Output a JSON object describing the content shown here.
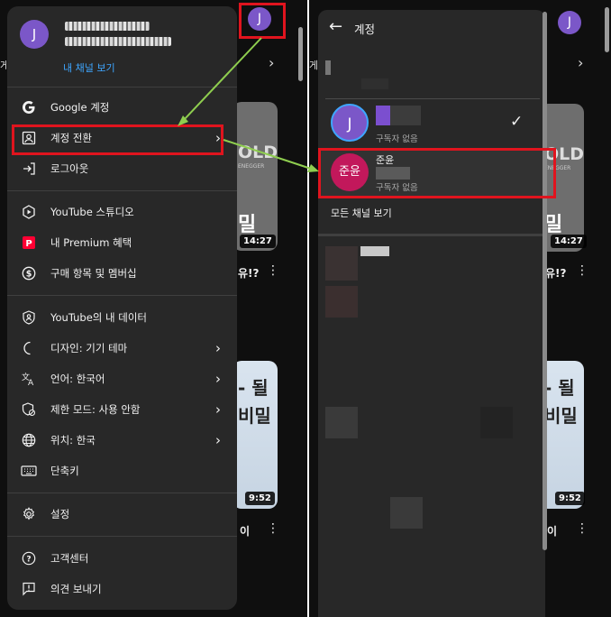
{
  "left": {
    "background": {
      "avatar_letter": "J",
      "edge_text": "게잍",
      "video1": {
        "thumb_text": "OLD",
        "thumb_subtext": "ENEGGER",
        "bottom_text": "밀",
        "duration": "14:27",
        "title": "유!?"
      },
      "video2": {
        "thumb_text": "- 될",
        "thumb_text2": "비밀",
        "duration": "9:52",
        "title": "이"
      }
    },
    "menu": {
      "avatar_letter": "J",
      "view_channel": "내 채널 보기",
      "items": [
        {
          "label": "Google 계정",
          "icon": "google-icon"
        },
        {
          "label": "계정 전환",
          "icon": "switch-account-icon",
          "chevron": true
        },
        {
          "label": "로그아웃",
          "icon": "logout-icon"
        },
        {
          "label": "YouTube 스튜디오",
          "icon": "studio-icon"
        },
        {
          "label": "내 Premium 혜택",
          "icon": "premium-icon"
        },
        {
          "label": "구매 항목 및 멤버십",
          "icon": "dollar-icon"
        },
        {
          "label": "YouTube의 내 데이터",
          "icon": "shield-user-icon"
        },
        {
          "label": "디자인: 기기 테마",
          "icon": "moon-icon",
          "chevron": true
        },
        {
          "label": "언어: 한국어",
          "icon": "translate-icon",
          "chevron": true
        },
        {
          "label": "제한 모드: 사용 안함",
          "icon": "restricted-icon",
          "chevron": true
        },
        {
          "label": "위치: 한국",
          "icon": "globe-icon",
          "chevron": true
        },
        {
          "label": "단축키",
          "icon": "keyboard-icon"
        },
        {
          "label": "설정",
          "icon": "gear-icon"
        },
        {
          "label": "고객센터",
          "icon": "help-icon"
        },
        {
          "label": "의견 보내기",
          "icon": "feedback-icon"
        }
      ]
    }
  },
  "right": {
    "background": {
      "avatar_letter": "J",
      "edge_text": "게잍",
      "video1": {
        "thumb_text": "OLD",
        "thumb_subtext": "ENEGGER",
        "bottom_text": "밀",
        "duration": "14:27",
        "title": "유!?"
      },
      "video2": {
        "thumb_text": "- 될",
        "thumb_text2": "비밀",
        "duration": "9:52",
        "title": "이"
      }
    },
    "switcher": {
      "title": "계정",
      "accounts": [
        {
          "avatar_letter": "J",
          "name": "",
          "subtitle": "구독자 없음",
          "selected": true
        },
        {
          "avatar_letter": "준윤",
          "name": "준윤",
          "subtitle": "구독자 없음",
          "selected": false
        }
      ],
      "all_channels": "모든 채널 보기"
    }
  },
  "colors": {
    "accent_red": "#e0141e",
    "arrow_green": "#8fce4f",
    "link_blue": "#3ea6ff",
    "avatar_purple": "#7b57c8",
    "avatar_pink": "#c2185b"
  }
}
